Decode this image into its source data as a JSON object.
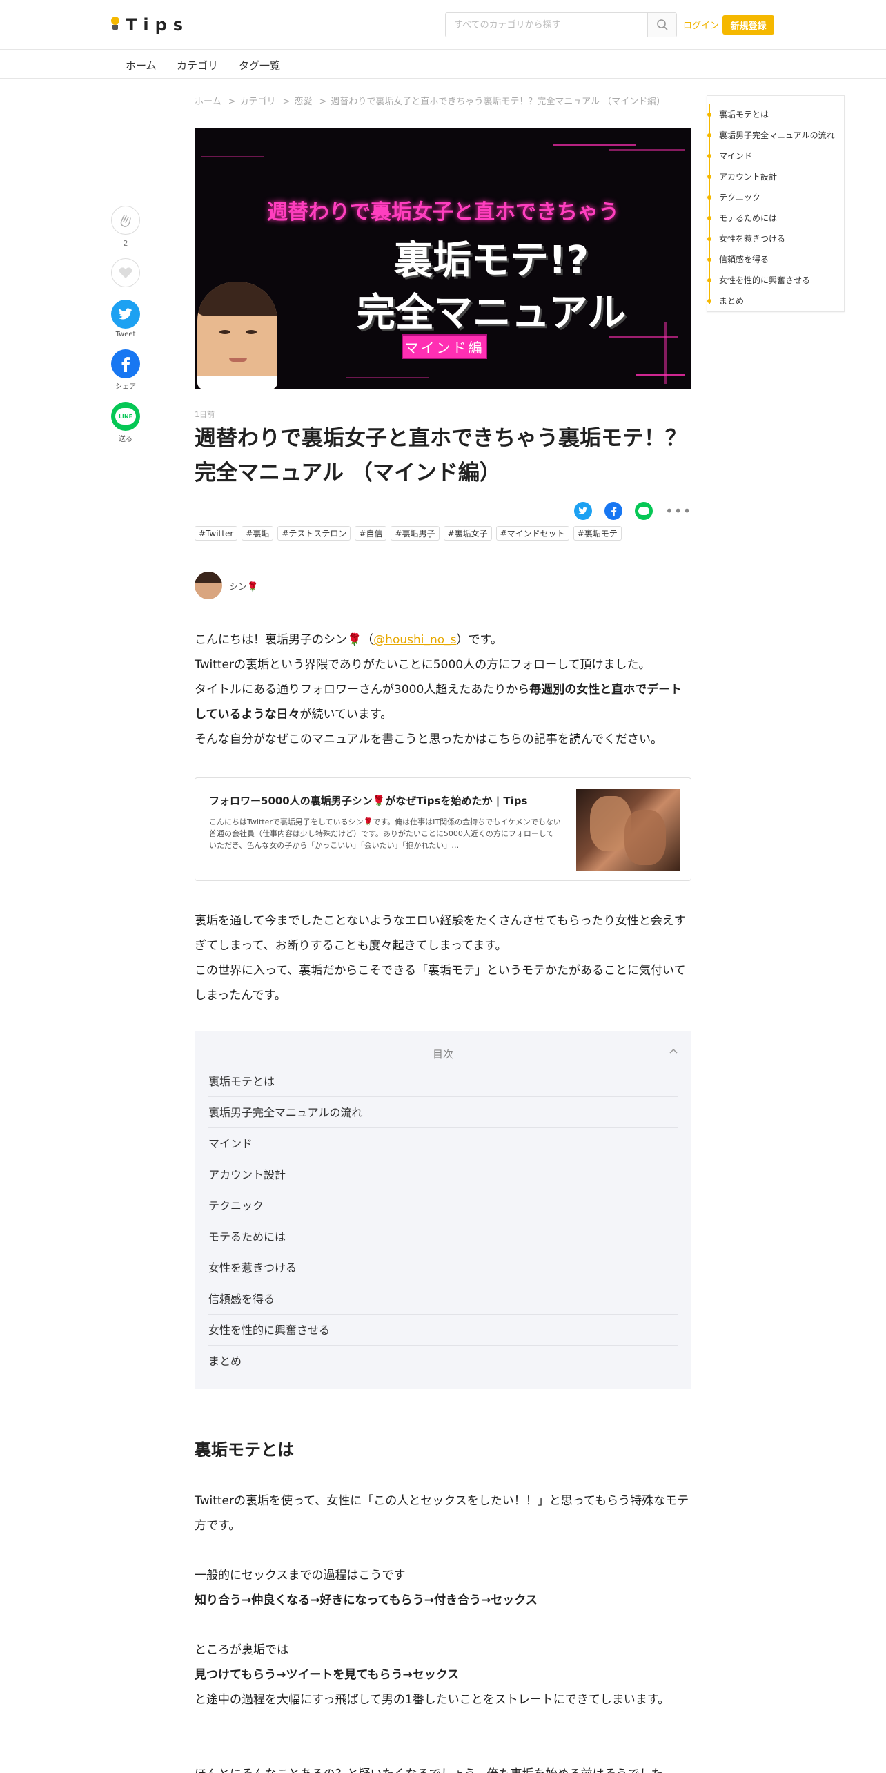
{
  "header": {
    "logo_text": "Tips",
    "search_placeholder": "すべてのカテゴリから探す",
    "login": "ログイン",
    "signup": "新規登録"
  },
  "nav": {
    "home": "ホーム",
    "category": "カテゴリ",
    "tags": "タグ一覧"
  },
  "breadcrumb": {
    "items": [
      "ホーム",
      "カテゴリ",
      "恋愛",
      "週替わりで裏垢女子と直ホできちゃう裏垢モテ！？完全マニュアル （マインド編）"
    ]
  },
  "share": {
    "clap_count": "2",
    "tweet": "Tweet",
    "facebook": "シェア",
    "line": "送る",
    "line_icon_text": "LINE"
  },
  "hero": {
    "line1": "週替わりで裏垢女子と直ホできちゃう",
    "line2": "裏垢モテ!?",
    "line3": "完全マニュアル",
    "badge": "マインド編"
  },
  "article": {
    "time": "1日前",
    "title": "週替わりで裏垢女子と直ホできちゃう裏垢モテ！？完全マニュアル （マインド編）",
    "tags": [
      "#Twitter",
      "#裏垢",
      "#テストステロン",
      "#自信",
      "#裏垢男子",
      "#裏垢女子",
      "#マインドセット",
      "#裏垢モテ"
    ],
    "author": "シン🌹",
    "intro": {
      "l1a": "こんにちは！裏垢男子のシン🌹（",
      "handle": "@houshi_no_s",
      "l1b": "）です。",
      "l2": "Twitterの裏垢という界隈でありがたいことに5000人の方にフォローして頂けました。",
      "l3a": "タイトルにある通りフォロワーさんが3000人超えたあたりから",
      "l3b": "毎週別の女性と直ホでデートしているような日々",
      "l3c": "が続いています。",
      "l4": "そんな自分がなぜこのマニュアルを書こうと思ったかはこちらの記事を読んでください。"
    },
    "card": {
      "title": "フォロワー5000人の裏垢男子シン🌹がなぜTipsを始めたか | Tips",
      "desc": "こんにちはTwitterで裏垢男子をしているシン🌹です。俺は仕事はIT関係の金持ちでもイケメンでもない普通の会社員（仕事内容は少し特殊だけど）です。ありがたいことに5000人近くの方にフォローしていただき、色んな女の子から「かっこいい」「会いたい」「抱かれたい」…"
    },
    "para2": {
      "l1": "裏垢を通して今までしたことないようなエロい経験をたくさんさせてもらったり女性と会えすぎてしまって、お断りすることも度々起きてしまってます。",
      "l2": "この世界に入って、裏垢だからこそできる「裏垢モテ」というモテかたがあることに気付いてしまったんです。"
    },
    "toc_title": "目次",
    "toc": [
      "裏垢モテとは",
      "裏垢男子完全マニュアルの流れ",
      "マインド",
      "アカウント設計",
      "テクニック",
      "モテるためには",
      "女性を惹きつける",
      "信頼感を得る",
      "女性を性的に興奮させる",
      "まとめ"
    ],
    "section1": {
      "heading": "裏垢モテとは",
      "p1": "Twitterの裏垢を使って、女性に「この人とセックスをしたい！！」と思ってもらう特殊なモテ方です。",
      "p2": "一般的にセックスまでの過程はこうです",
      "p3": "知り合う→仲良くなる→好きになってもらう→付き合う→セックス",
      "p4": "ところが裏垢では",
      "p5": "見つけてもらう→ツイートを見てもらう→セックス",
      "p6": "と途中の過程を大幅にすっ飛ばして男の1番したいことをストレートにできてしまいます。",
      "p7": "ほんとにそんなことあるの？と疑いたくなるでしょう。俺も裏垢を始める前はそうでした"
    }
  },
  "right_toc": [
    "裏垢モテとは",
    "裏垢男子完全マニュアルの流れ",
    "マインド",
    "アカウント設計",
    "テクニック",
    "モテるためには",
    "女性を惹きつける",
    "信頼感を得る",
    "女性を性的に興奮させる",
    "まとめ"
  ],
  "colors": {
    "accent": "#f5b800",
    "twitter": "#1da1f2",
    "facebook": "#1877f2",
    "line": "#06c755",
    "hero_pink": "#ff2fb3"
  }
}
